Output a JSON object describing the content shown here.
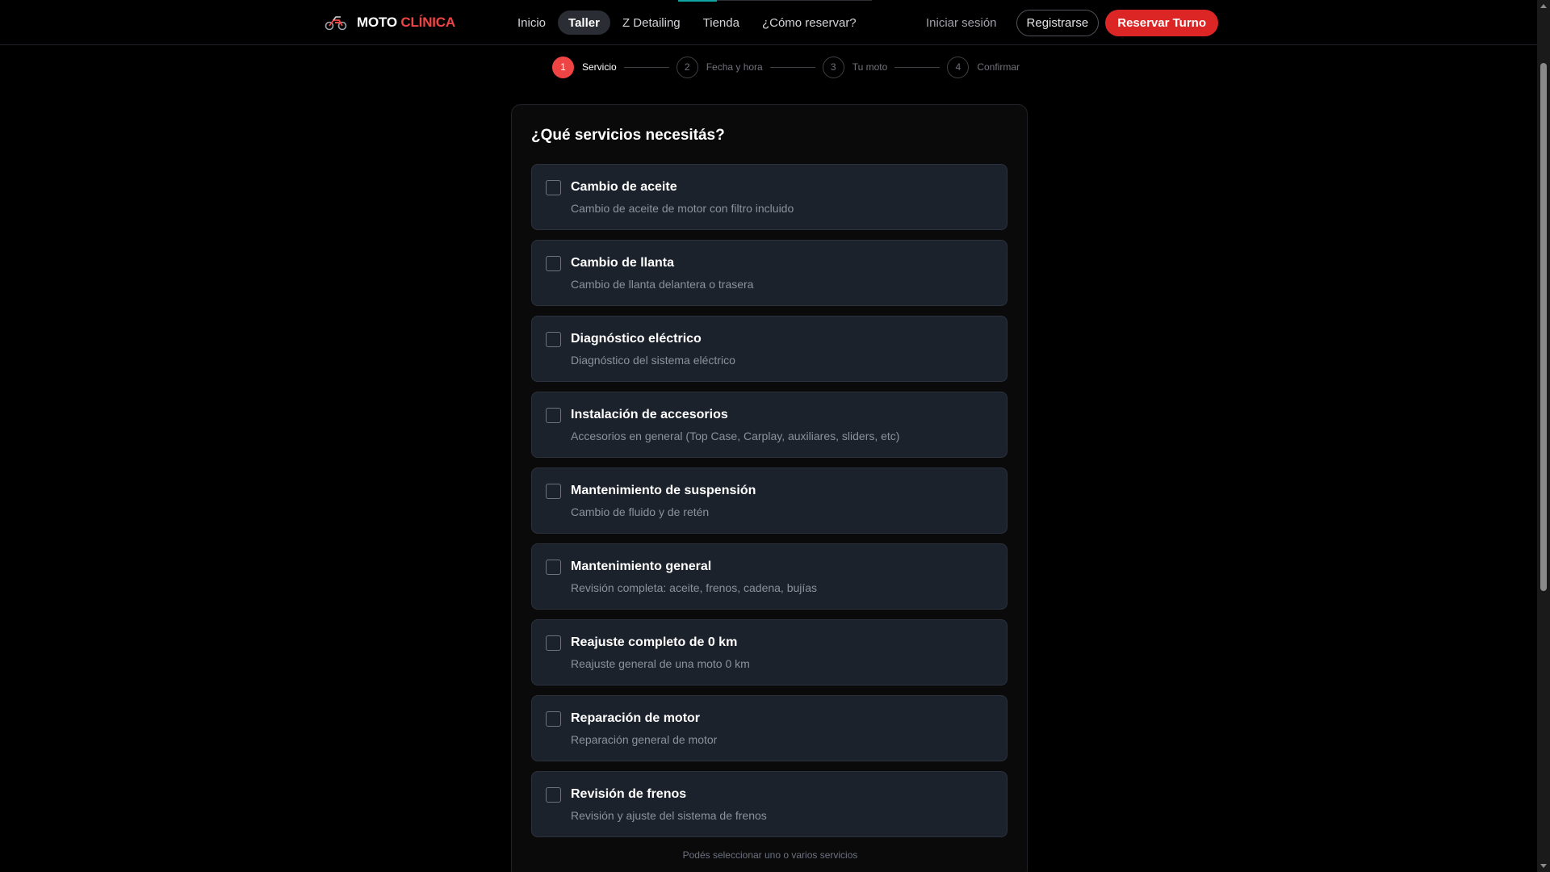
{
  "brand": {
    "first": "MOTO",
    "second": "CLÍNICA",
    "accent": "#ef4444"
  },
  "nav": {
    "links": [
      {
        "label": "Inicio"
      },
      {
        "label": "Taller"
      },
      {
        "label": "Z Detailing"
      },
      {
        "label": "Tienda"
      },
      {
        "label": "¿Cómo reservar?"
      }
    ],
    "login": "Iniciar sesión",
    "register": "Registrarse",
    "book": "Reservar Turno"
  },
  "stepper": [
    {
      "num": "1",
      "label": "Servicio"
    },
    {
      "num": "2",
      "label": "Fecha y hora"
    },
    {
      "num": "3",
      "label": "Tu moto"
    },
    {
      "num": "4",
      "label": "Confirmar"
    }
  ],
  "card": {
    "title": "¿Qué servicios necesitás?",
    "hint": "Podés seleccionar uno o varios servicios"
  },
  "services": [
    {
      "name": "Cambio de aceite",
      "desc": "Cambio de aceite de motor con filtro incluido"
    },
    {
      "name": "Cambio de llanta",
      "desc": "Cambio de llanta delantera o trasera"
    },
    {
      "name": "Diagnóstico eléctrico",
      "desc": "Diagnóstico del sistema eléctrico"
    },
    {
      "name": "Instalación de accesorios",
      "desc": "Accesorios en general (Top Case, Carplay, auxiliares, sliders, etc)"
    },
    {
      "name": "Mantenimiento de suspensión",
      "desc": "Cambio de fluido y de retén"
    },
    {
      "name": "Mantenimiento general",
      "desc": "Revisión completa: aceite, frenos, cadena, bujías"
    },
    {
      "name": "Reajuste completo de 0 km",
      "desc": "Reajuste general de una moto 0 km"
    },
    {
      "name": "Reparación de motor",
      "desc": "Reparación general de motor"
    },
    {
      "name": "Revisión de frenos",
      "desc": "Revisión y ajuste del sistema de frenos"
    }
  ]
}
